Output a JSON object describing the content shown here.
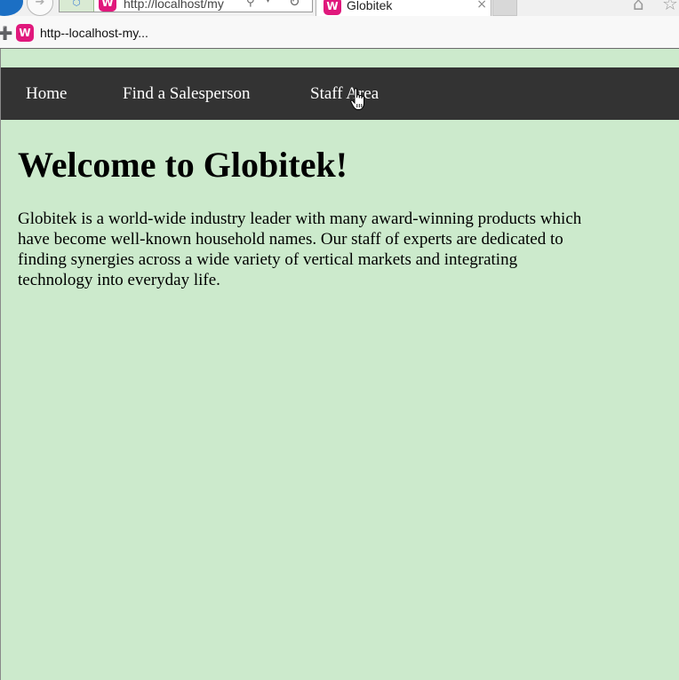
{
  "browser": {
    "address_url": "http://localhost/my",
    "tab_title": "Globitek",
    "tab_close": "×",
    "favorite_label": "http--localhost-my..."
  },
  "icons": {
    "back": "back-icon",
    "forward": "forward-icon",
    "compat": "compatibility-view-icon",
    "wamp": "wamp-site-icon",
    "search": "search-icon",
    "refresh": "refresh-icon",
    "home": "home-icon",
    "favorites": "favorites-star-icon"
  },
  "nav": {
    "home": "Home",
    "find_salesperson": "Find a Salesperson",
    "staff_area": "Staff Area"
  },
  "main": {
    "heading": "Welcome to Globitek!",
    "intro": "Globitek is a world-wide industry leader with many award-winning products which have become well-known household names. Our staff of experts are dedicated to finding synergies across a wide variety of vertical markets and integrating technology into everyday life."
  },
  "colors": {
    "page_background": "#cceacc",
    "navbar_background": "#333333",
    "nav_text": "#ffffff",
    "site_icon": "#e0187c"
  }
}
